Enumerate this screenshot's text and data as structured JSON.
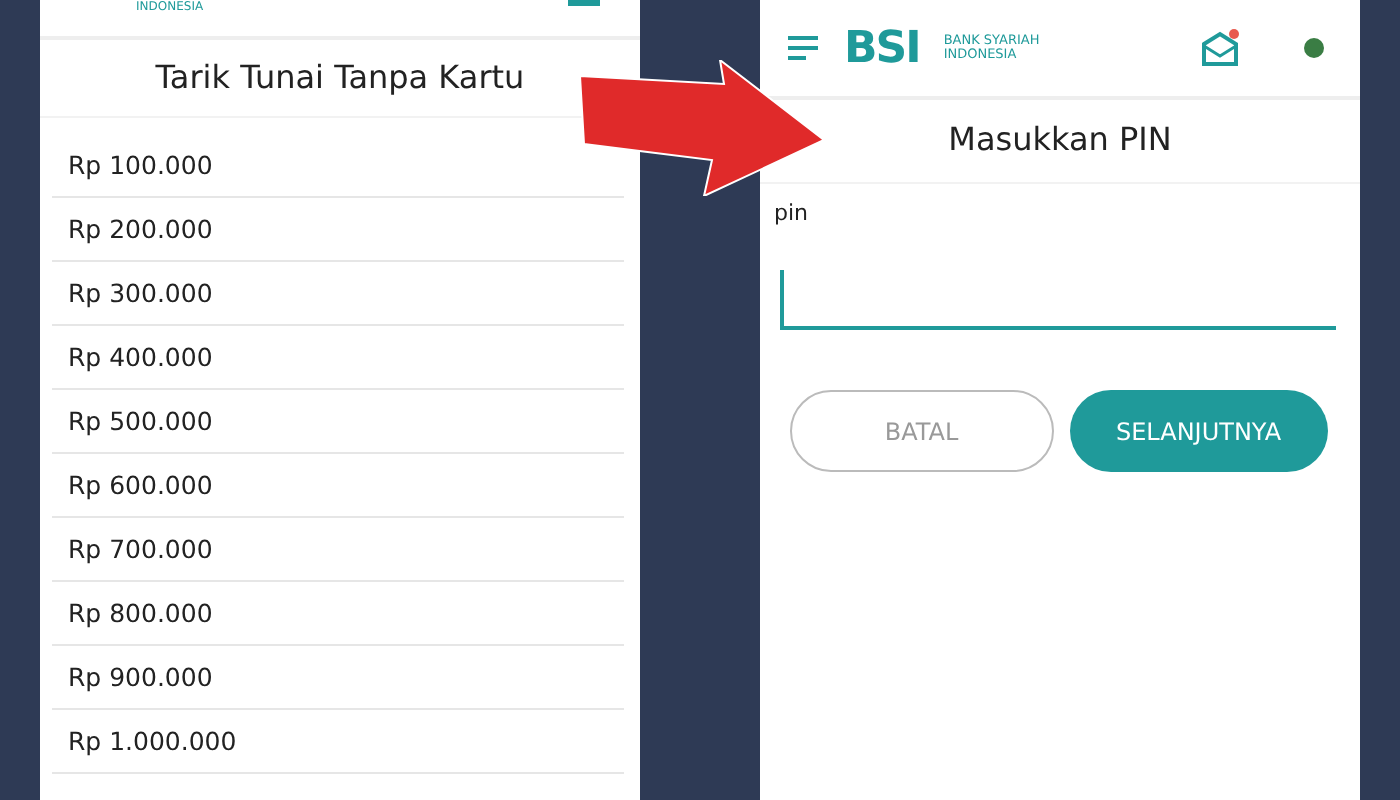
{
  "left_screen": {
    "header": {
      "logo_subtitle": "INDONESIA"
    },
    "title": "Tarik Tunai Tanpa Kartu",
    "amounts": [
      {
        "label": "Rp 100.000"
      },
      {
        "label": "Rp 200.000"
      },
      {
        "label": "Rp 300.000"
      },
      {
        "label": "Rp 400.000"
      },
      {
        "label": "Rp 500.000"
      },
      {
        "label": "Rp 600.000"
      },
      {
        "label": "Rp 700.000"
      },
      {
        "label": "Rp 800.000"
      },
      {
        "label": "Rp 900.000"
      },
      {
        "label": "Rp 1.000.000"
      }
    ]
  },
  "right_screen": {
    "header": {
      "logo": "BSI",
      "logo_subtitle_1": "BANK SYARIAH",
      "logo_subtitle_2": "INDONESIA"
    },
    "title": "Masukkan PIN",
    "pin_field": {
      "label": "pin"
    },
    "buttons": [
      {
        "label": "BATAL",
        "kind": "outline"
      },
      {
        "label": "SELANJUTNYA",
        "kind": "filled"
      }
    ]
  }
}
